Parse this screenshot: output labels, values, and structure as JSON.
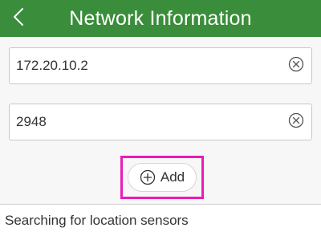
{
  "header": {
    "title": "Network Information",
    "back_icon": "chevron-left-icon",
    "background_color": "#3a8d3a"
  },
  "fields": [
    {
      "value": "172.20.10.2",
      "clear_icon": "clear-circle-icon"
    },
    {
      "value": "2948",
      "clear_icon": "clear-circle-icon"
    }
  ],
  "add_button": {
    "label": "Add",
    "icon": "plus-circle-icon",
    "highlight_color": "#ea1cb8"
  },
  "status": {
    "text": "Searching for location sensors"
  }
}
